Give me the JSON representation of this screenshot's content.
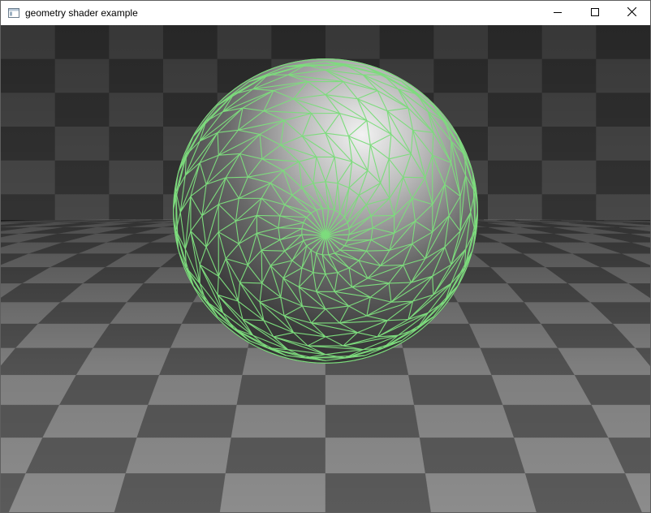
{
  "window": {
    "title": "geometry shader example",
    "icon": "app-window-icon",
    "controls": {
      "minimize_icon": "minimize-icon",
      "maximize_icon": "maximize-icon",
      "close_icon": "close-icon"
    }
  },
  "scene": {
    "floor_colors": {
      "light": "#8c8c8c",
      "dark": "#5a5a5a"
    },
    "wall_colors": {
      "light": "#555555",
      "dark": "#3c3c3c"
    },
    "sphere_color": "#9a9a9a",
    "wireframe_color": "#7ddc7d"
  }
}
